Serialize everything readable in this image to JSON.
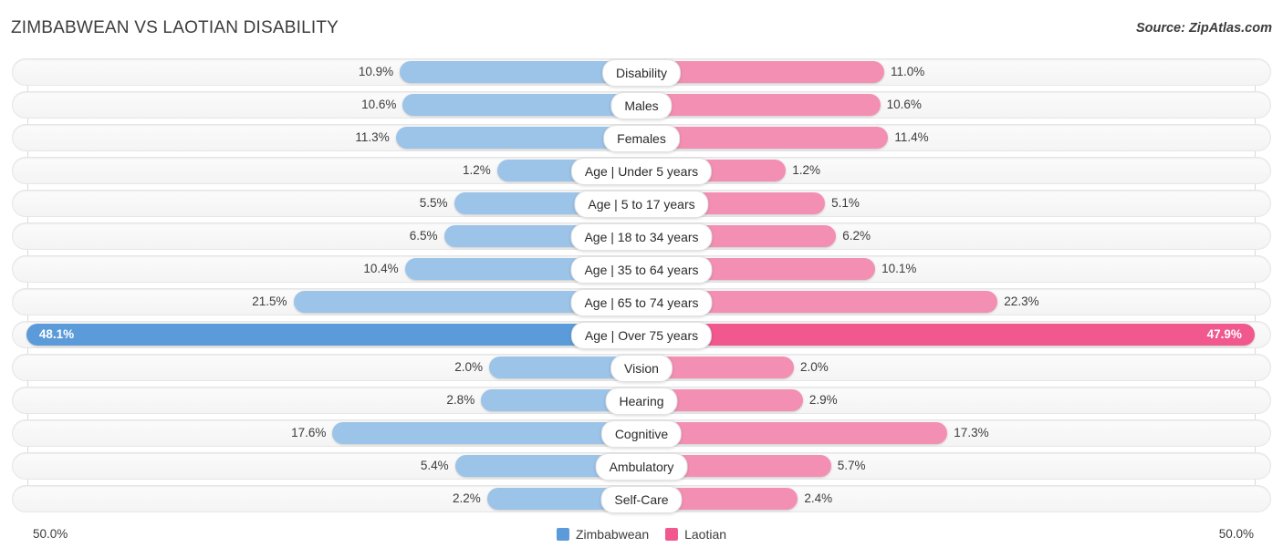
{
  "header": {
    "title": "ZIMBABWEAN VS LAOTIAN DISABILITY",
    "source": "Source: ZipAtlas.com"
  },
  "axis": {
    "left_label": "50.0%",
    "right_label": "50.0%"
  },
  "legend": {
    "items": [
      {
        "label": "Zimbabwean",
        "color": "#5b9bd9"
      },
      {
        "label": "Laotian",
        "color": "#f0588e"
      }
    ]
  },
  "chart_data": {
    "type": "bar",
    "title": "ZIMBABWEAN VS LAOTIAN DISABILITY",
    "subtitle": "Source: ZipAtlas.com",
    "orientation": "horizontal-diverging",
    "xlabel": "",
    "ylabel": "",
    "xlim": [
      50.0,
      50.0
    ],
    "grid": true,
    "legend_position": "bottom-center",
    "categories": [
      "Disability",
      "Males",
      "Females",
      "Age | Under 5 years",
      "Age | 5 to 17 years",
      "Age | 18 to 34 years",
      "Age | 35 to 64 years",
      "Age | 65 to 74 years",
      "Age | Over 75 years",
      "Vision",
      "Hearing",
      "Cognitive",
      "Ambulatory",
      "Self-Care"
    ],
    "series": [
      {
        "name": "Zimbabwean",
        "color": "#9cc3e8",
        "values": [
          10.9,
          10.6,
          11.3,
          1.2,
          5.5,
          6.5,
          10.4,
          21.5,
          48.1,
          2.0,
          2.8,
          17.6,
          5.4,
          2.2
        ],
        "labels": [
          "10.9%",
          "10.6%",
          "11.3%",
          "1.2%",
          "5.5%",
          "6.5%",
          "10.4%",
          "21.5%",
          "48.1%",
          "2.0%",
          "2.8%",
          "17.6%",
          "5.4%",
          "2.2%"
        ]
      },
      {
        "name": "Laotian",
        "color": "#f48fb4",
        "values": [
          11.0,
          10.6,
          11.4,
          1.2,
          5.1,
          6.2,
          10.1,
          22.3,
          47.9,
          2.0,
          2.9,
          17.3,
          5.7,
          2.4
        ],
        "labels": [
          "11.0%",
          "10.6%",
          "11.4%",
          "1.2%",
          "5.1%",
          "6.2%",
          "10.1%",
          "22.3%",
          "47.9%",
          "2.0%",
          "2.9%",
          "17.3%",
          "5.7%",
          "2.4%"
        ]
      }
    ],
    "highlighted_rows": [
      8
    ]
  },
  "rows": [
    {
      "label": "Disability",
      "left": "10.9%",
      "right": "11.0%",
      "lv": 10.9,
      "rv": 11.0,
      "hl": false
    },
    {
      "label": "Males",
      "left": "10.6%",
      "right": "10.6%",
      "lv": 10.6,
      "rv": 10.6,
      "hl": false
    },
    {
      "label": "Females",
      "left": "11.3%",
      "right": "11.4%",
      "lv": 11.3,
      "rv": 11.4,
      "hl": false
    },
    {
      "label": "Age | Under 5 years",
      "left": "1.2%",
      "right": "1.2%",
      "lv": 1.2,
      "rv": 1.2,
      "hl": false
    },
    {
      "label": "Age | 5 to 17 years",
      "left": "5.5%",
      "right": "5.1%",
      "lv": 5.5,
      "rv": 5.1,
      "hl": false
    },
    {
      "label": "Age | 18 to 34 years",
      "left": "6.5%",
      "right": "6.2%",
      "lv": 6.5,
      "rv": 6.2,
      "hl": false
    },
    {
      "label": "Age | 35 to 64 years",
      "left": "10.4%",
      "right": "10.1%",
      "lv": 10.4,
      "rv": 10.1,
      "hl": false
    },
    {
      "label": "Age | 65 to 74 years",
      "left": "21.5%",
      "right": "22.3%",
      "lv": 21.5,
      "rv": 22.3,
      "hl": false
    },
    {
      "label": "Age | Over 75 years",
      "left": "48.1%",
      "right": "47.9%",
      "lv": 48.1,
      "rv": 47.9,
      "hl": true
    },
    {
      "label": "Vision",
      "left": "2.0%",
      "right": "2.0%",
      "lv": 2.0,
      "rv": 2.0,
      "hl": false
    },
    {
      "label": "Hearing",
      "left": "2.8%",
      "right": "2.9%",
      "lv": 2.8,
      "rv": 2.9,
      "hl": false
    },
    {
      "label": "Cognitive",
      "left": "17.6%",
      "right": "17.3%",
      "lv": 17.6,
      "rv": 17.3,
      "hl": false
    },
    {
      "label": "Ambulatory",
      "left": "5.4%",
      "right": "5.7%",
      "lv": 5.4,
      "rv": 5.7,
      "hl": false
    },
    {
      "label": "Self-Care",
      "left": "2.2%",
      "right": "2.4%",
      "lv": 2.2,
      "rv": 2.4,
      "hl": false
    }
  ]
}
